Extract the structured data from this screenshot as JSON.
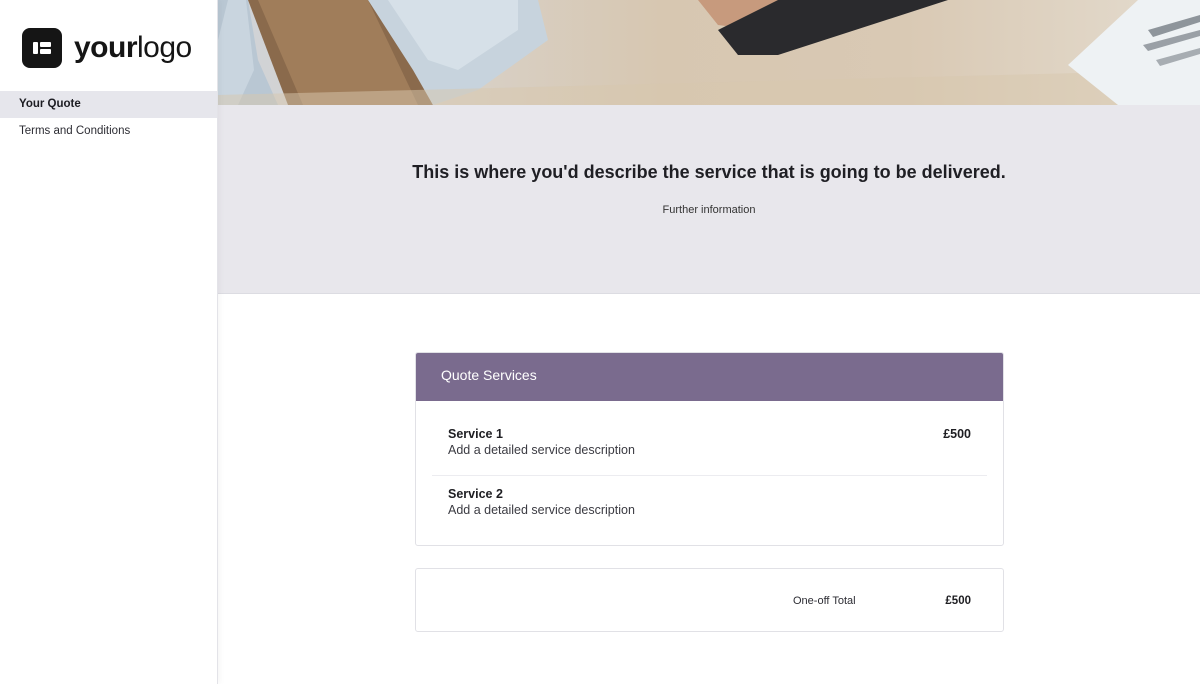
{
  "logo": {
    "text_bold": "your",
    "text_light": "logo"
  },
  "sidebar": {
    "items": [
      {
        "label": "Your Quote",
        "active": true
      },
      {
        "label": "Terms and Conditions",
        "active": false
      }
    ]
  },
  "intro": {
    "title": "This is where you'd describe the service that is going to be delivered.",
    "subtitle": "Further information"
  },
  "quote": {
    "header": "Quote Services",
    "services": [
      {
        "name": "Service 1",
        "description": "Add a detailed service description",
        "price": "£500"
      },
      {
        "name": "Service 2",
        "description": "Add a detailed service description",
        "price": ""
      }
    ],
    "total_label": "One-off Total",
    "total_value": "£500"
  },
  "colors": {
    "accent": "#7a6b8e",
    "intro_bg": "#e8e7ec",
    "active_nav_bg": "#e6e6ec"
  }
}
